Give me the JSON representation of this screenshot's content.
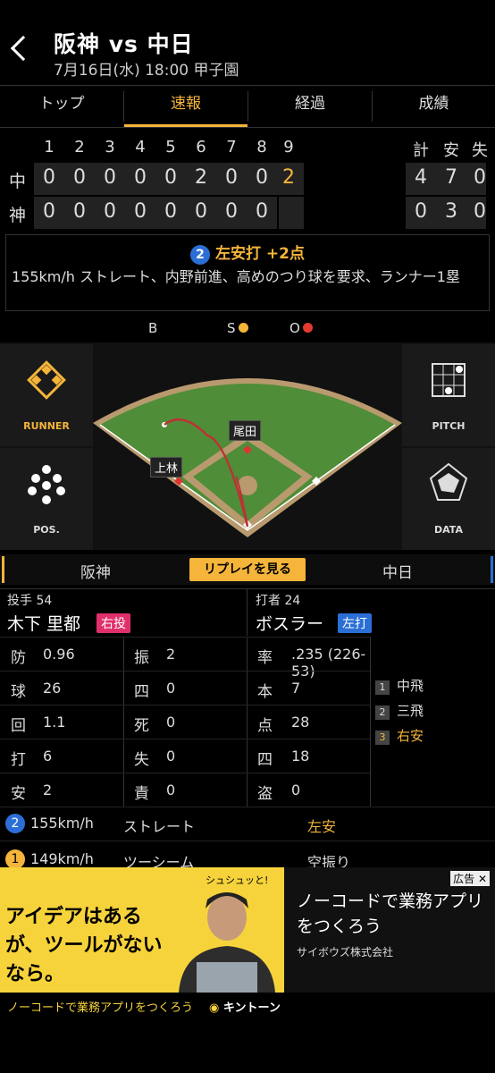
{
  "header": {
    "title": "阪神 vs 中日",
    "subtitle": "7月16日(水) 18:00 甲子園"
  },
  "tabs": [
    {
      "label": "トップ",
      "active": false
    },
    {
      "label": "速報",
      "active": true
    },
    {
      "label": "経過",
      "active": false
    },
    {
      "label": "成績",
      "active": false
    }
  ],
  "scoreboard": {
    "innings": [
      "1",
      "2",
      "3",
      "4",
      "5",
      "6",
      "7",
      "8",
      "9"
    ],
    "total_headers": [
      "計",
      "安",
      "失"
    ],
    "rows": [
      {
        "team": "中",
        "scores": [
          "0",
          "0",
          "0",
          "0",
          "0",
          "2",
          "0",
          "0",
          "2"
        ],
        "totals": [
          "4",
          "7",
          "0"
        ]
      },
      {
        "team": "神",
        "scores": [
          "0",
          "0",
          "0",
          "0",
          "0",
          "0",
          "0",
          "0",
          ""
        ],
        "totals": [
          "0",
          "3",
          "0"
        ]
      }
    ]
  },
  "play": {
    "num": "2",
    "title": "左安打 +2点",
    "text": "155km/h ストレート、内野前進、高めのつり球を要求、ランナー1塁"
  },
  "bso": {
    "b": "B",
    "s": "S",
    "o": "O"
  },
  "field": {
    "runner_label": "RUNNER",
    "pos_label": "POS.",
    "pitch_label": "PITCH",
    "data_label": "DATA",
    "fielder1": "尾田",
    "fielder2": "上林"
  },
  "teambar": {
    "home": "阪神",
    "replay": "リプレイを見る",
    "away": "中日"
  },
  "pitcher": {
    "label": "投手 54",
    "name": "木下 里都",
    "hand": "右投",
    "stats": [
      {
        "k": "防",
        "v": "0.96",
        "k2": "振",
        "v2": "2"
      },
      {
        "k": "球",
        "v": "26",
        "k2": "四",
        "v2": "0"
      },
      {
        "k": "回",
        "v": "1.1",
        "k2": "死",
        "v2": "0"
      },
      {
        "k": "打",
        "v": "6",
        "k2": "失",
        "v2": "0"
      },
      {
        "k": "安",
        "v": "2",
        "k2": "責",
        "v2": "0"
      }
    ]
  },
  "batter": {
    "label": "打者 24",
    "name": "ボスラー",
    "hand": "左打",
    "stats": [
      {
        "k": "率",
        "v": ".235 (226-53)"
      },
      {
        "k": "本",
        "v": "7"
      },
      {
        "k": "点",
        "v": "28"
      },
      {
        "k": "四",
        "v": "18"
      },
      {
        "k": "盗",
        "v": "0"
      }
    ],
    "at_bats": [
      {
        "n": "1",
        "r": "中飛"
      },
      {
        "n": "2",
        "r": "三飛"
      },
      {
        "n": "3",
        "r": "右安"
      }
    ]
  },
  "pitches": [
    {
      "n": "2",
      "speed": "155km/h",
      "type": "ストレート",
      "result": "左安"
    },
    {
      "n": "1",
      "speed": "149km/h",
      "type": "ツーシーム",
      "result": "空振り"
    }
  ],
  "ad": {
    "headline": "アイデアはあるが、ツールがないなら。",
    "bubble": "シュシュッと!",
    "copy": "ノーコードで業務アプリをつくろう",
    "company": "サイボウズ株式会社",
    "footer": "ノーコードで業務アプリをつくろう",
    "brand": "キントーン",
    "tag": "広告"
  },
  "colors": {
    "accent": "#f5b53a",
    "pitcher_badge": "#e0306b",
    "batter_badge": "#2b6fd6",
    "strike": "#f5b53a",
    "out": "#e33b2e"
  }
}
